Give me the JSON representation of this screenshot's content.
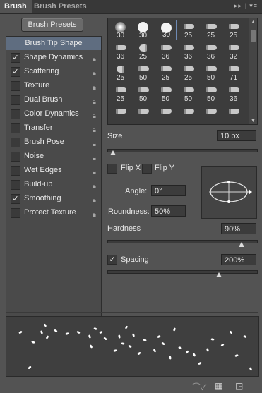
{
  "tabs": [
    {
      "label": "Brush",
      "active": true
    },
    {
      "label": "Brush Presets",
      "active": false
    }
  ],
  "panel_menu_icon": "flyout-menu-icon",
  "left_panel": {
    "presets_button": "Brush Presets",
    "items": [
      {
        "label": "Brush Tip Shape",
        "selected": true
      },
      {
        "label": "Shape Dynamics",
        "checked": true
      },
      {
        "label": "Scattering",
        "checked": true
      },
      {
        "label": "Texture",
        "checked": false
      },
      {
        "label": "Dual Brush",
        "checked": false
      },
      {
        "label": "Color Dynamics",
        "checked": false
      },
      {
        "label": "Transfer",
        "checked": false
      },
      {
        "label": "Brush Pose",
        "checked": false
      },
      {
        "label": "Noise",
        "checked": false
      },
      {
        "label": "Wet Edges",
        "checked": false
      },
      {
        "label": "Build-up",
        "checked": false
      },
      {
        "label": "Smoothing",
        "checked": true
      },
      {
        "label": "Protect Texture",
        "checked": false
      }
    ]
  },
  "brush_tips": [
    [
      "30",
      "30",
      "30",
      "25",
      "25",
      "25"
    ],
    [
      "36",
      "25",
      "36",
      "36",
      "36",
      "32"
    ],
    [
      "25",
      "50",
      "25",
      "25",
      "50",
      "71"
    ],
    [
      "25",
      "50",
      "50",
      "50",
      "50",
      "36"
    ],
    [
      "",
      "",
      "",
      "",
      "",
      ""
    ]
  ],
  "selected_tip": "30",
  "size": {
    "label": "Size",
    "value": "10 px",
    "slider_fraction": 0.04
  },
  "flip_x": {
    "label": "Flip X",
    "checked": false
  },
  "flip_y": {
    "label": "Flip Y",
    "checked": false
  },
  "angle": {
    "label": "Angle:",
    "value": "0°"
  },
  "roundness": {
    "label": "Roundness:",
    "value": "50%"
  },
  "hardness": {
    "label": "Hardness",
    "value": "90%",
    "slider_fraction": 0.9
  },
  "spacing": {
    "label": "Spacing",
    "value": "200%",
    "checked": true,
    "slider_fraction": 0.75
  },
  "bottom_icons": [
    "brush-edit-icon",
    "grid-icon",
    "new-preset-icon"
  ]
}
